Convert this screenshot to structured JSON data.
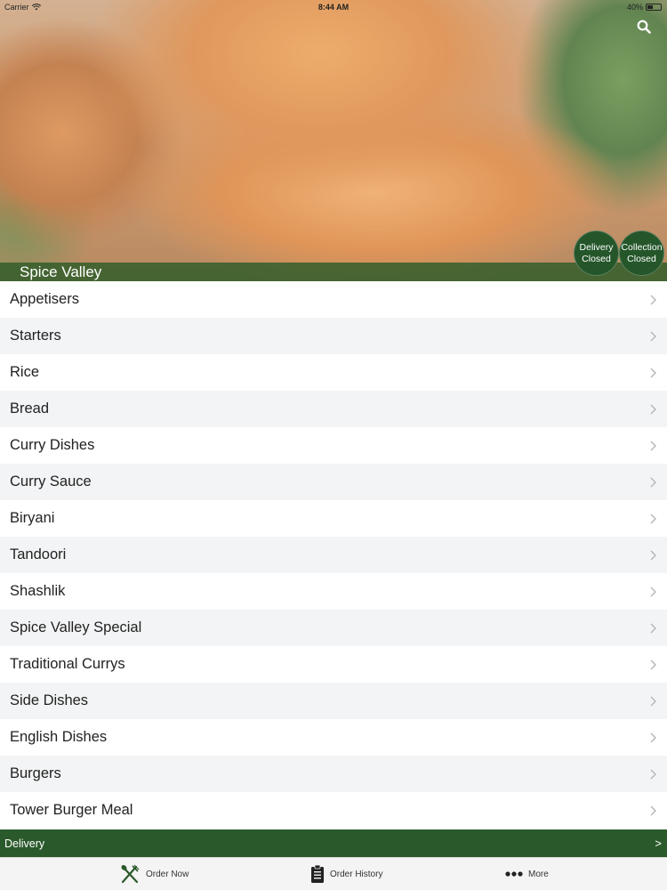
{
  "status_bar": {
    "carrier": "Carrier",
    "time": "8:44 AM",
    "battery": "40%"
  },
  "header": {
    "restaurant_name": "Spice Valley",
    "search_icon": "search-icon",
    "delivery_status": {
      "line1": "Delivery",
      "line2": "Closed"
    },
    "collection_status": {
      "line1": "Collection",
      "line2": "Closed"
    }
  },
  "menu": {
    "categories": [
      "Appetisers",
      "Starters",
      "Rice",
      "Bread",
      "Curry Dishes",
      "Curry Sauce",
      "Biryani",
      "Tandoori",
      "Shashlik",
      "Spice Valley Special",
      "Traditional Currys",
      "Side Dishes",
      "English Dishes",
      "Burgers",
      "Tower Burger Meal"
    ]
  },
  "delivery_bar": {
    "label": "Delivery",
    "arrow": ">"
  },
  "tabs": {
    "order_now": "Order Now",
    "order_history": "Order History",
    "more": "More"
  },
  "colors": {
    "brand_green": "#2a5a2b",
    "circle_green": "#24562a",
    "row_alt": "#f3f4f5"
  }
}
